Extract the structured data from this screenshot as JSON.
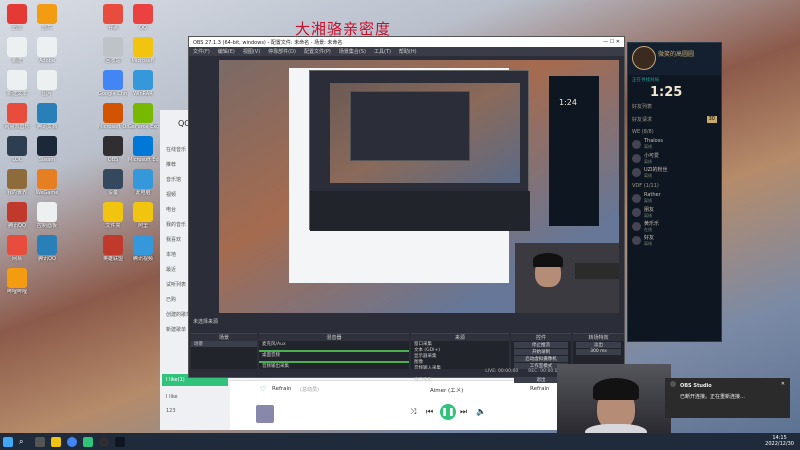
{
  "desktop": {
    "banner": "大湘骆亲密度",
    "icons": [
      {
        "label": "迅雷",
        "color": "#e53935"
      },
      {
        "label": "蓝鸟",
        "color": "#f39c12"
      },
      {
        "label": "谷歌",
        "color": "#e74c3c"
      },
      {
        "label": "QQ",
        "color": "#ec4141"
      },
      {
        "label": "新建",
        "color": "#ecf0f1"
      },
      {
        "label": "Adobe",
        "color": "#ecf0f1"
      },
      {
        "label": "回收站",
        "color": "#bdc3c7"
      },
      {
        "label": "Microsoft",
        "color": "#f1c40f"
      },
      {
        "label": "新建文本",
        "color": "#ecf0f1"
      },
      {
        "label": "图片",
        "color": "#ecf0f1"
      },
      {
        "label": "Google Chrome",
        "color": "#4285f4"
      },
      {
        "label": "WinRAR",
        "color": "#3498db"
      },
      {
        "label": "网易云音乐",
        "color": "#e74c3c"
      },
      {
        "label": "腾讯文档",
        "color": "#2980b9"
      },
      {
        "label": "Microsoft Office",
        "color": "#d35400"
      },
      {
        "label": "GeForce Experience",
        "color": "#76b900"
      },
      {
        "label": "LOL",
        "color": "#2c3e50"
      },
      {
        "label": "Steam",
        "color": "#1b2838"
      },
      {
        "label": "OBS",
        "color": "#302e31"
      },
      {
        "label": "Microsoft Edge",
        "color": "#0078d7"
      },
      {
        "label": "我的世界",
        "color": "#8e6b3a"
      },
      {
        "label": "WeGame",
        "color": "#e67e22"
      },
      {
        "label": "设备",
        "color": "#34495e"
      },
      {
        "label": "此电脑",
        "color": "#3498db"
      },
      {
        "label": "腾讯QQ",
        "color": "#c0392b"
      },
      {
        "label": "控制面板",
        "color": "#ecf0f1"
      },
      {
        "label": "文件夹",
        "color": "#f1c40f"
      },
      {
        "label": "阿里",
        "color": "#f1c40f"
      },
      {
        "label": "网易",
        "color": "#e74c3c"
      },
      {
        "label": "腾讯QQ",
        "color": "#2980b9"
      },
      {
        "label": "英雄联盟",
        "color": "#c0392b"
      },
      {
        "label": "腾讯视频",
        "color": "#3498db"
      },
      {
        "label": "哔哩哔哩",
        "color": "#f39c12"
      }
    ]
  },
  "qqmusic": {
    "title": "QQ音乐",
    "nav": [
      "在线音乐",
      "推荐",
      "音乐馆",
      "视频",
      "电台",
      "我的音乐",
      "我喜欢",
      "本地",
      "最近",
      "试听列表",
      "已购",
      "创建的歌单",
      "新建歌单"
    ],
    "selected": "I like(1)",
    "extra": [
      "I like",
      "123"
    ],
    "now_playing": {
      "song": "Refrain",
      "album": "(总动员)",
      "artist": "Aimer (エメ)",
      "right": "Refrain"
    }
  },
  "obs": {
    "title": "OBS 27.1.3 (64-bit, windows) - 配置文件: 未命名 - 场景: 未命名",
    "menu": [
      "文件(F)",
      "编辑(E)",
      "视图(V)",
      "停靠部件(D)",
      "配置文件(P)",
      "场景集合(S)",
      "工具(T)",
      "帮助(H)"
    ],
    "scene_label": "未选择来源",
    "docks": {
      "scenes": {
        "title": "场景",
        "items": [
          "场景"
        ]
      },
      "sources": {
        "title": "来源",
        "items": [
          "窗口采集",
          "文本 (GDI+)",
          "显示器采集",
          "图像",
          "音频输入采集",
          "音频输出采集",
          "窗口采集"
        ]
      },
      "mixer": {
        "title": "混音器",
        "items": [
          "麦克风/Aux",
          "桌面音频",
          "音频输出采集"
        ]
      },
      "transitions": {
        "title": "转场特效",
        "value": "淡出",
        "duration": "300 ms"
      },
      "controls": {
        "title": "控件",
        "buttons": [
          "停止推流",
          "开始录制",
          "启动虚拟摄像机",
          "工作室模式",
          "设置",
          "退出"
        ]
      }
    },
    "status": {
      "live": "LIVE: 00:00:00",
      "rec": "REC: 00:00:00",
      "cpu": "CPU: 1.4%, 60.00 fps"
    }
  },
  "lol": {
    "name": "微笑的高圆圆",
    "room": "正在寻找对局",
    "timer": "1:25",
    "section": "好友列表",
    "friends_group": "好友请求",
    "count": "30",
    "groups": [
      "WE (8/8)",
      "VDF (1/11)"
    ],
    "friends": [
      {
        "name": "Thaloss",
        "status": "离线"
      },
      {
        "name": "小可爱",
        "status": "离线"
      },
      {
        "name": "UZI的粉丝",
        "status": "离线"
      },
      {
        "name": "Rather",
        "status": "离线"
      },
      {
        "name": "朋友",
        "status": "离线"
      },
      {
        "name": "黄乐乐",
        "status": "在线"
      },
      {
        "name": "好友",
        "status": "离线"
      }
    ]
  },
  "notification": {
    "app": "OBS Studio",
    "text": "已断开连接。正在重新连接…"
  },
  "clock": {
    "time": "14:15",
    "date": "2022/12/30"
  }
}
